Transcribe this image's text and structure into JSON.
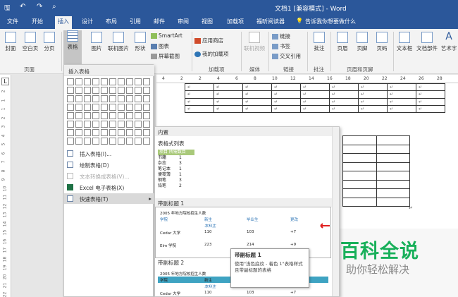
{
  "title": "文档1 [兼容模式] - Word",
  "tabs": [
    "文件",
    "开始",
    "插入",
    "设计",
    "布局",
    "引用",
    "邮件",
    "审阅",
    "视图",
    "加载项",
    "福昕阅读器"
  ],
  "tell_me": "告诉我你想要做什么",
  "ribbon": {
    "cover": "封面",
    "blank": "空白页",
    "pagebreak": "分页",
    "table": "表格",
    "picture": "图片",
    "online_picture": "联机图片",
    "shapes": "形状",
    "smartart": "SmartArt",
    "chart": "图表",
    "screenshot": "屏幕截图",
    "app_store": "应用商店",
    "my_addins": "我的加载项",
    "online_video": "联机视频",
    "link": "链接",
    "bookmark": "书签",
    "crossref": "交叉引用",
    "comment": "批注",
    "header": "页眉",
    "footer": "页脚",
    "page_num": "页码",
    "textbox": "文本框",
    "docparts": "文档部件",
    "wordart": "艺术字",
    "g_pages": "页面",
    "g_addins": "加载项",
    "g_media": "媒体",
    "g_links": "链接",
    "g_comment": "批注",
    "g_hf": "页眉和页脚"
  },
  "dropdown": {
    "header": "插入表格",
    "items": [
      "插入表格(I)...",
      "绘制表格(D)",
      "文本转换成表格(V)...",
      "Excel 电子表格(X)",
      "快速表格(T)"
    ]
  },
  "submenu": {
    "header1": "内置",
    "label1": "表格式列表",
    "listA": {
      "head": "项目  所需数目",
      "rows": [
        [
          "书籍",
          "1"
        ],
        [
          "杂志",
          "3"
        ],
        [
          "笔记本",
          "1"
        ],
        [
          "便笺簿",
          "1"
        ],
        [
          "钢笔",
          "3"
        ],
        [
          "铅笔",
          "2"
        ]
      ]
    },
    "header2": "带副标题 1",
    "header3": "带副标题 2",
    "sample": {
      "title": "2005 年地方院校招生人数",
      "c1": "学院",
      "c2": "新生",
      "c3": "毕业生",
      "c4": "更改",
      "sub": "本科生",
      "r1": [
        "Cedar 大学",
        "110",
        "103",
        "+7"
      ],
      "r2": [
        "Elm 学院",
        "223",
        "214",
        "+9"
      ]
    }
  },
  "tooltip": {
    "title": "带副标题 1",
    "desc": "使用\"浅色底纹 - 着色 1\"表格样式且带副标题的表格"
  },
  "watermark": {
    "big": "百科全说",
    "small": "助你轻松解决"
  },
  "ruler": {
    "nums": [
      "4",
      "2",
      "2",
      "4",
      "6",
      "8",
      "10",
      "12",
      "14",
      "16",
      "18",
      "20",
      "22",
      "24",
      "26",
      "28"
    ],
    "vnums": [
      "2",
      "1",
      "1",
      "2",
      "3",
      "4",
      "5",
      "6",
      "7",
      "8",
      "9",
      "10",
      "11",
      "12",
      "13",
      "14",
      "15",
      "16",
      "17",
      "18",
      "19",
      "20",
      "21",
      "22"
    ]
  }
}
